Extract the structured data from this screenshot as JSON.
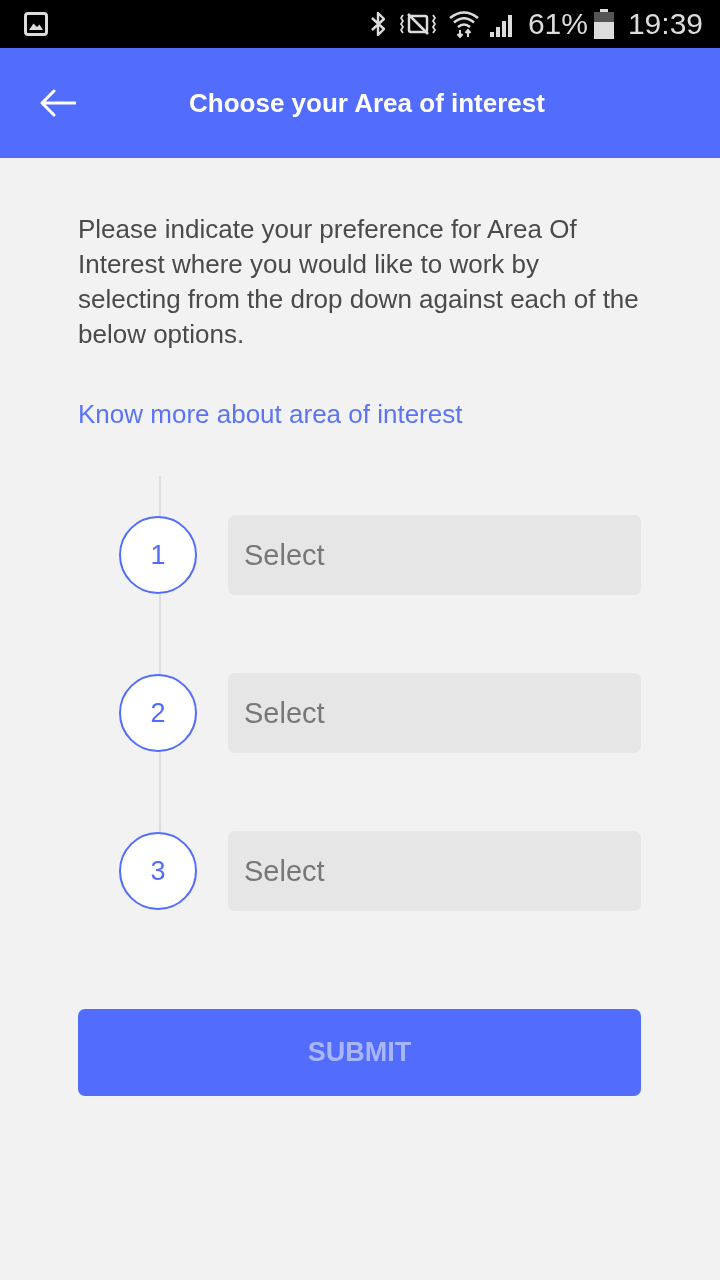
{
  "status_bar": {
    "battery": "61%",
    "time": "19:39"
  },
  "app_bar": {
    "title": "Choose your Area of interest"
  },
  "intro": "Please indicate your preference for Area Of Interest where you would like to work by selecting from the drop down against each of the below options.",
  "link": "Know more about area of interest",
  "preferences": [
    {
      "number": "1",
      "placeholder": "Select"
    },
    {
      "number": "2",
      "placeholder": "Select"
    },
    {
      "number": "3",
      "placeholder": "Select"
    }
  ],
  "submit": {
    "label": "SUBMIT",
    "disabled": true
  }
}
